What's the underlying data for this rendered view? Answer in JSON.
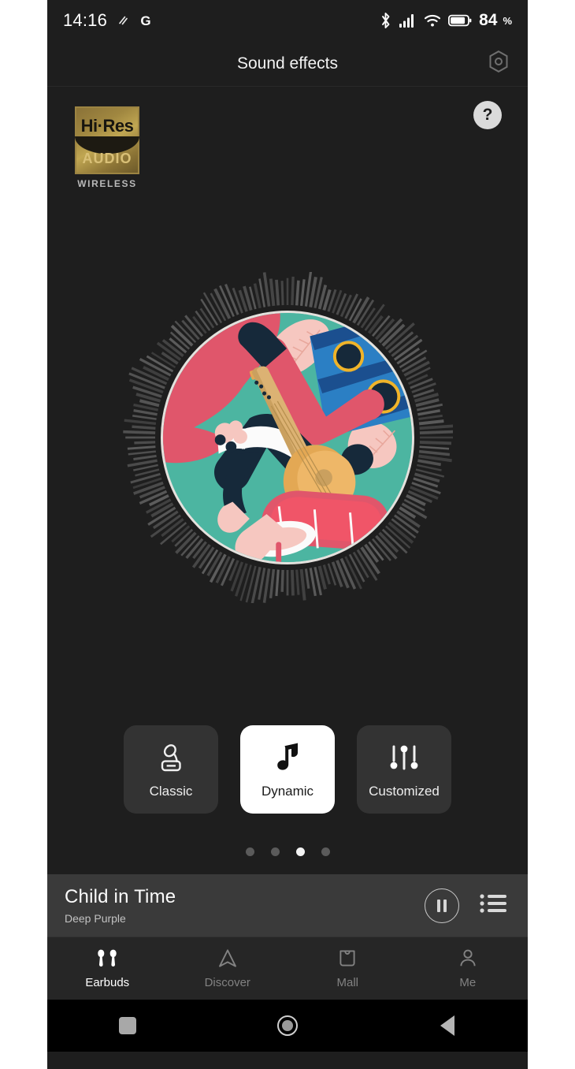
{
  "status_bar": {
    "time": "14:16",
    "icons_left": [
      "silent-mode-icon",
      "google-icon"
    ],
    "icons_right": [
      "bluetooth-icon",
      "cellular-signal-icon",
      "wifi-icon",
      "battery-icon"
    ],
    "battery_level": "84",
    "battery_unit": "%"
  },
  "app_bar": {
    "title": "Sound effects",
    "settings_icon": "hex-gear-icon"
  },
  "content": {
    "hires_badge": {
      "line1": "Hi·Res",
      "line2": "AUDIO",
      "line3": "WIRELESS"
    },
    "help_button": {
      "label": "?",
      "icon": "question-mark-icon"
    },
    "album_art": {
      "icon": "album-artwork-guitarist",
      "colors": {
        "teal": "#4cb5a1",
        "coral": "#e0566b",
        "blue": "#2b7fc4",
        "blue_dark": "#1b4f8f",
        "guitar": "#e3a854",
        "pink": "#f6c7c0",
        "navy": "#16293a",
        "gold": "#f0b429",
        "ring": "#e4e1dd"
      },
      "visualizer_color": "#5e5e5e"
    },
    "modes": [
      {
        "label": "Classic",
        "icon": "gramophone-icon",
        "selected": false
      },
      {
        "label": "Dynamic",
        "icon": "music-note-icon",
        "selected": true
      },
      {
        "label": "Customized",
        "icon": "equalizer-sliders-icon",
        "selected": false
      }
    ],
    "page_dots": {
      "count": 4,
      "active_index": 2
    }
  },
  "now_playing": {
    "title": "Child in Time",
    "artist": "Deep Purple",
    "pause_icon": "pause-circle-icon",
    "queue_icon": "playlist-icon"
  },
  "bottom_tabs": [
    {
      "label": "Earbuds",
      "icon": "earbuds-icon",
      "active": true
    },
    {
      "label": "Discover",
      "icon": "compass-icon",
      "active": false
    },
    {
      "label": "Mall",
      "icon": "shopping-bag-icon",
      "active": false
    },
    {
      "label": "Me",
      "icon": "person-icon",
      "active": false
    }
  ],
  "android_nav": [
    {
      "icon": "recents-square-icon"
    },
    {
      "icon": "home-circle-icon"
    },
    {
      "icon": "back-triangle-icon"
    }
  ],
  "theme": {
    "background": "#1e1e1e",
    "surface": "#333333",
    "now_playing_bg": "#3a3a3a",
    "tabbar_bg": "#262626",
    "accent_white": "#ffffff",
    "muted_text": "#828282"
  }
}
